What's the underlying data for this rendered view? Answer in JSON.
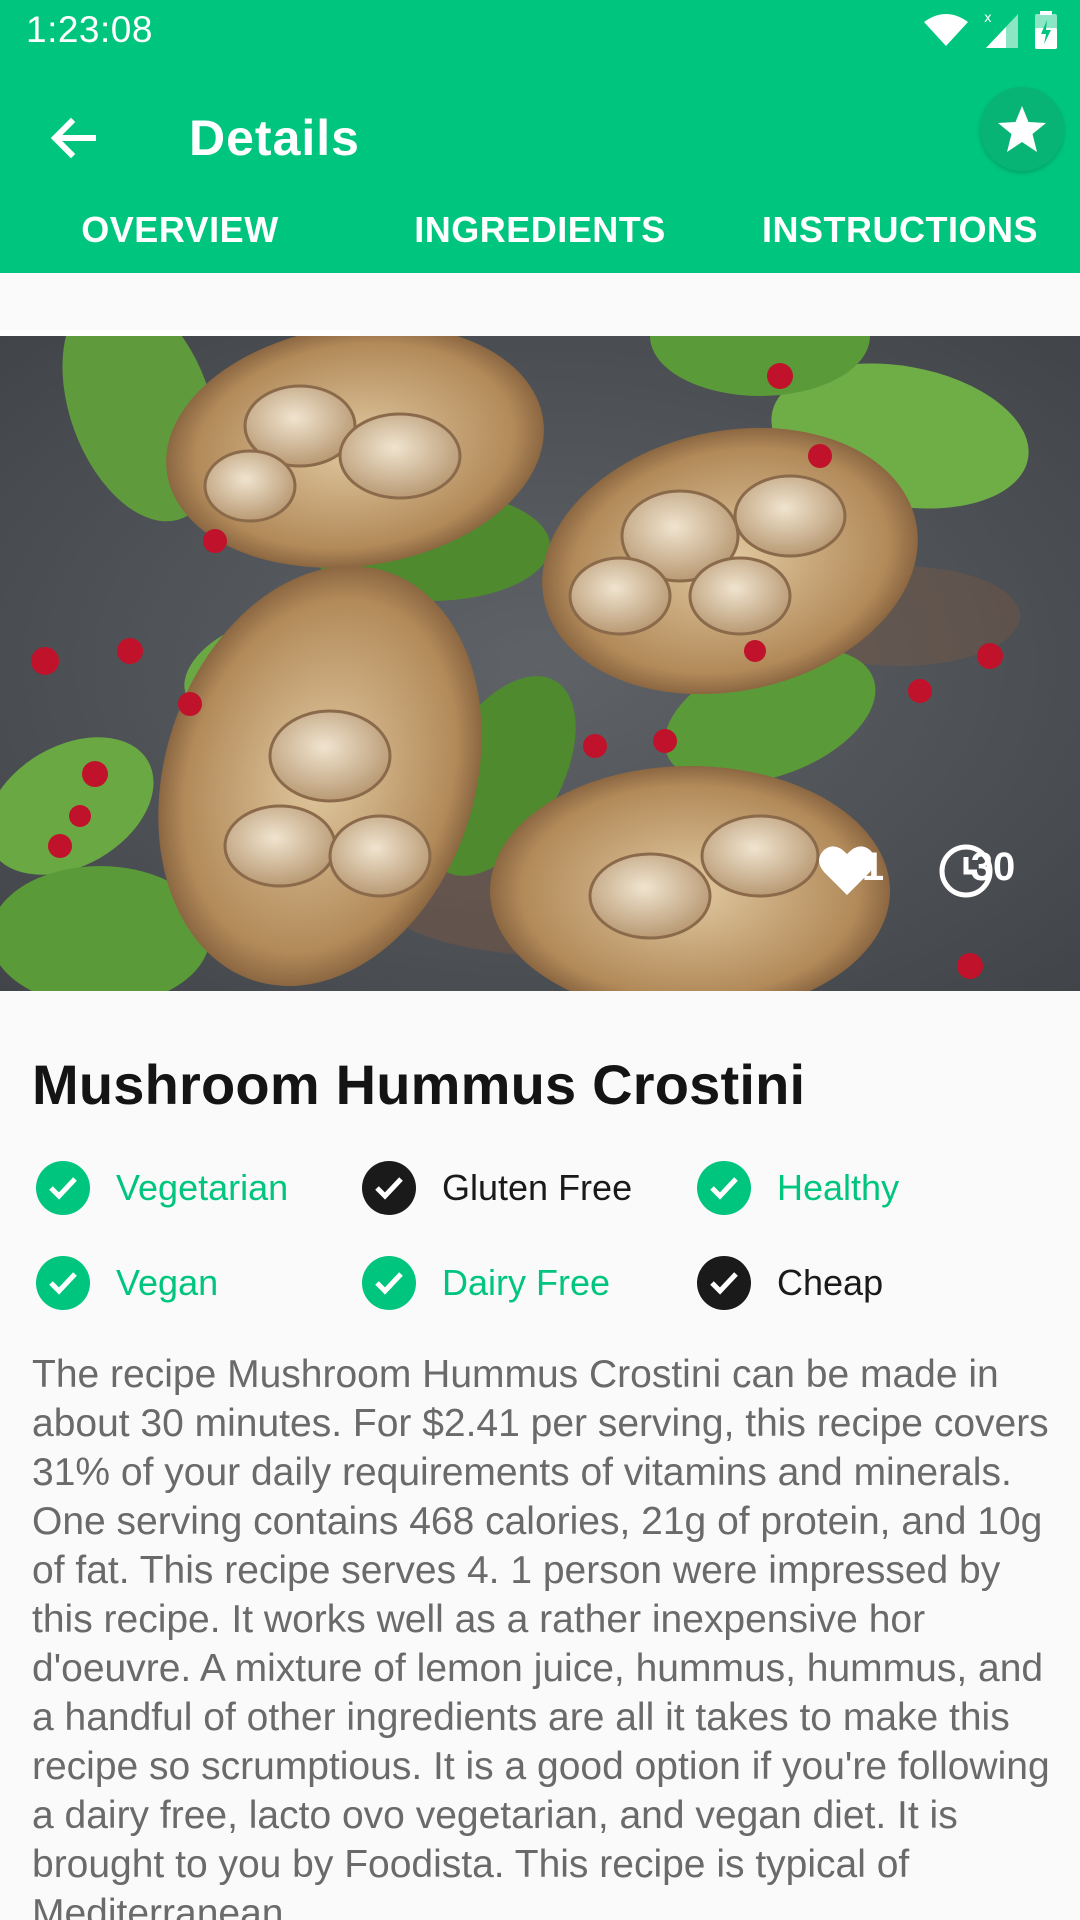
{
  "status_bar": {
    "time": "1:23:08"
  },
  "app_bar": {
    "title": "Details"
  },
  "tabs": [
    {
      "label": "OVERVIEW",
      "selected": true
    },
    {
      "label": "INGREDIENTS",
      "selected": false
    },
    {
      "label": "INSTRUCTIONS",
      "selected": false
    }
  ],
  "hero": {
    "likes": "1",
    "minutes": "30"
  },
  "recipe": {
    "title": "Mushroom Hummus Crostini",
    "tags": [
      {
        "label": "Vegetarian",
        "active": true
      },
      {
        "label": "Gluten Free",
        "active": false
      },
      {
        "label": "Healthy",
        "active": true
      },
      {
        "label": "Vegan",
        "active": true
      },
      {
        "label": "Dairy Free",
        "active": true
      },
      {
        "label": "Cheap",
        "active": false
      }
    ],
    "summary": "The recipe Mushroom Hummus Crostini can be made in about 30 minutes. For $2.41 per serving, this recipe covers 31% of your daily requirements of vitamins and minerals. One serving contains 468 calories, 21g of protein, and 10g of fat. This recipe serves 4. 1 person were impressed by this recipe. It works well as a rather inexpensive hor d'oeuvre. A mixture of lemon juice, hummus, hummus, and a handful of other ingredients are all it takes to make this recipe so scrumptious. It is a good option if you're following a dairy free, lacto ovo vegetarian, and vegan diet. It is brought to you by Foodista. This recipe is typical of Mediterranean"
  },
  "colors": {
    "primary": "#00c57f",
    "inactive": "#1a1a1a",
    "summary_text": "#6a6a6a"
  },
  "icons": {
    "back": "arrow-back-icon",
    "favorite": "star-icon",
    "likes": "heart-icon",
    "time": "clock-icon",
    "tag_check": "check-circle-icon"
  }
}
